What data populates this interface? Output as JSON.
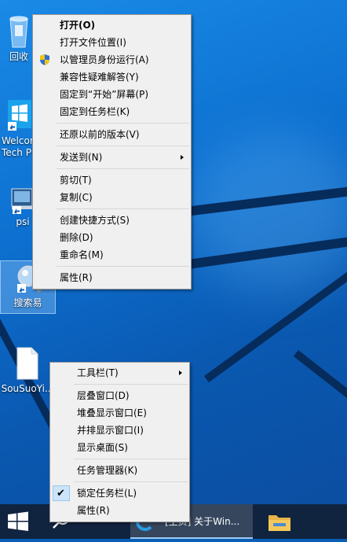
{
  "desktop": {
    "icons": [
      {
        "label": "回收",
        "icon": "recycle-bin-icon"
      },
      {
        "label": "Welcom",
        "label2": "Tech P",
        "icon": "windows-logo-icon"
      },
      {
        "label": "psi",
        "icon": "monitor-icon"
      },
      {
        "label": "搜索易",
        "icon": "magnifier-icon"
      },
      {
        "label": "SouSuoYi...",
        "icon": "file-icon"
      }
    ]
  },
  "file_menu": {
    "items": [
      {
        "label": "打开(O)",
        "bold": true
      },
      {
        "label": "打开文件位置(I)"
      },
      {
        "label": "以管理员身份运行(A)",
        "icon": "uac-shield-icon"
      },
      {
        "label": "兼容性疑难解答(Y)"
      },
      {
        "label": "固定到“开始”屏幕(P)"
      },
      {
        "label": "固定到任务栏(K)"
      },
      {
        "label": "还原以前的版本(V)"
      },
      {
        "label": "发送到(N)",
        "submenu": true
      },
      {
        "label": "剪切(T)"
      },
      {
        "label": "复制(C)"
      },
      {
        "label": "创建快捷方式(S)"
      },
      {
        "label": "删除(D)"
      },
      {
        "label": "重命名(M)"
      },
      {
        "label": "属性(R)"
      }
    ]
  },
  "taskbar_menu": {
    "items": [
      {
        "label": "工具栏(T)",
        "submenu": true
      },
      {
        "label": "层叠窗口(D)"
      },
      {
        "label": "堆叠显示窗口(E)"
      },
      {
        "label": "并排显示窗口(I)"
      },
      {
        "label": "显示桌面(S)"
      },
      {
        "label": "任务管理器(K)"
      },
      {
        "label": "锁定任务栏(L)",
        "checked": true
      },
      {
        "label": "属性(R)"
      }
    ]
  },
  "taskbar": {
    "start_icon": "windows-start-icon",
    "search_icon": "search-icon",
    "window_title": "[主页] 关于Win...",
    "explorer_icon": "folder-icon",
    "accent": "#10233f"
  }
}
